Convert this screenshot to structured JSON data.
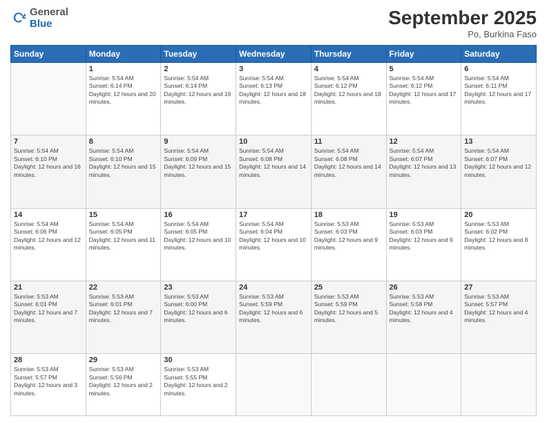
{
  "header": {
    "logo_general": "General",
    "logo_blue": "Blue",
    "month_title": "September 2025",
    "subtitle": "Po, Burkina Faso"
  },
  "weekdays": [
    "Sunday",
    "Monday",
    "Tuesday",
    "Wednesday",
    "Thursday",
    "Friday",
    "Saturday"
  ],
  "weeks": [
    [
      {
        "day": "",
        "sunrise": "",
        "sunset": "",
        "daylight": ""
      },
      {
        "day": "1",
        "sunrise": "Sunrise: 5:54 AM",
        "sunset": "Sunset: 6:14 PM",
        "daylight": "Daylight: 12 hours and 20 minutes."
      },
      {
        "day": "2",
        "sunrise": "Sunrise: 5:54 AM",
        "sunset": "Sunset: 6:14 PM",
        "daylight": "Daylight: 12 hours and 19 minutes."
      },
      {
        "day": "3",
        "sunrise": "Sunrise: 5:54 AM",
        "sunset": "Sunset: 6:13 PM",
        "daylight": "Daylight: 12 hours and 18 minutes."
      },
      {
        "day": "4",
        "sunrise": "Sunrise: 5:54 AM",
        "sunset": "Sunset: 6:12 PM",
        "daylight": "Daylight: 12 hours and 18 minutes."
      },
      {
        "day": "5",
        "sunrise": "Sunrise: 5:54 AM",
        "sunset": "Sunset: 6:12 PM",
        "daylight": "Daylight: 12 hours and 17 minutes."
      },
      {
        "day": "6",
        "sunrise": "Sunrise: 5:54 AM",
        "sunset": "Sunset: 6:11 PM",
        "daylight": "Daylight: 12 hours and 17 minutes."
      }
    ],
    [
      {
        "day": "7",
        "sunrise": "Sunrise: 5:54 AM",
        "sunset": "Sunset: 6:10 PM",
        "daylight": "Daylight: 12 hours and 16 minutes."
      },
      {
        "day": "8",
        "sunrise": "Sunrise: 5:54 AM",
        "sunset": "Sunset: 6:10 PM",
        "daylight": "Daylight: 12 hours and 15 minutes."
      },
      {
        "day": "9",
        "sunrise": "Sunrise: 5:54 AM",
        "sunset": "Sunset: 6:09 PM",
        "daylight": "Daylight: 12 hours and 15 minutes."
      },
      {
        "day": "10",
        "sunrise": "Sunrise: 5:54 AM",
        "sunset": "Sunset: 6:08 PM",
        "daylight": "Daylight: 12 hours and 14 minutes."
      },
      {
        "day": "11",
        "sunrise": "Sunrise: 5:54 AM",
        "sunset": "Sunset: 6:08 PM",
        "daylight": "Daylight: 12 hours and 14 minutes."
      },
      {
        "day": "12",
        "sunrise": "Sunrise: 5:54 AM",
        "sunset": "Sunset: 6:07 PM",
        "daylight": "Daylight: 12 hours and 13 minutes."
      },
      {
        "day": "13",
        "sunrise": "Sunrise: 5:54 AM",
        "sunset": "Sunset: 6:07 PM",
        "daylight": "Daylight: 12 hours and 12 minutes."
      }
    ],
    [
      {
        "day": "14",
        "sunrise": "Sunrise: 5:54 AM",
        "sunset": "Sunset: 6:06 PM",
        "daylight": "Daylight: 12 hours and 12 minutes."
      },
      {
        "day": "15",
        "sunrise": "Sunrise: 5:54 AM",
        "sunset": "Sunset: 6:05 PM",
        "daylight": "Daylight: 12 hours and 11 minutes."
      },
      {
        "day": "16",
        "sunrise": "Sunrise: 5:54 AM",
        "sunset": "Sunset: 6:05 PM",
        "daylight": "Daylight: 12 hours and 10 minutes."
      },
      {
        "day": "17",
        "sunrise": "Sunrise: 5:54 AM",
        "sunset": "Sunset: 6:04 PM",
        "daylight": "Daylight: 12 hours and 10 minutes."
      },
      {
        "day": "18",
        "sunrise": "Sunrise: 5:53 AM",
        "sunset": "Sunset: 6:03 PM",
        "daylight": "Daylight: 12 hours and 9 minutes."
      },
      {
        "day": "19",
        "sunrise": "Sunrise: 5:53 AM",
        "sunset": "Sunset: 6:03 PM",
        "daylight": "Daylight: 12 hours and 9 minutes."
      },
      {
        "day": "20",
        "sunrise": "Sunrise: 5:53 AM",
        "sunset": "Sunset: 6:02 PM",
        "daylight": "Daylight: 12 hours and 8 minutes."
      }
    ],
    [
      {
        "day": "21",
        "sunrise": "Sunrise: 5:53 AM",
        "sunset": "Sunset: 6:01 PM",
        "daylight": "Daylight: 12 hours and 7 minutes."
      },
      {
        "day": "22",
        "sunrise": "Sunrise: 5:53 AM",
        "sunset": "Sunset: 6:01 PM",
        "daylight": "Daylight: 12 hours and 7 minutes."
      },
      {
        "day": "23",
        "sunrise": "Sunrise: 5:53 AM",
        "sunset": "Sunset: 6:00 PM",
        "daylight": "Daylight: 12 hours and 6 minutes."
      },
      {
        "day": "24",
        "sunrise": "Sunrise: 5:53 AM",
        "sunset": "Sunset: 5:59 PM",
        "daylight": "Daylight: 12 hours and 6 minutes."
      },
      {
        "day": "25",
        "sunrise": "Sunrise: 5:53 AM",
        "sunset": "Sunset: 5:59 PM",
        "daylight": "Daylight: 12 hours and 5 minutes."
      },
      {
        "day": "26",
        "sunrise": "Sunrise: 5:53 AM",
        "sunset": "Sunset: 5:58 PM",
        "daylight": "Daylight: 12 hours and 4 minutes."
      },
      {
        "day": "27",
        "sunrise": "Sunrise: 5:53 AM",
        "sunset": "Sunset: 5:57 PM",
        "daylight": "Daylight: 12 hours and 4 minutes."
      }
    ],
    [
      {
        "day": "28",
        "sunrise": "Sunrise: 5:53 AM",
        "sunset": "Sunset: 5:57 PM",
        "daylight": "Daylight: 12 hours and 3 minutes."
      },
      {
        "day": "29",
        "sunrise": "Sunrise: 5:53 AM",
        "sunset": "Sunset: 5:56 PM",
        "daylight": "Daylight: 12 hours and 2 minutes."
      },
      {
        "day": "30",
        "sunrise": "Sunrise: 5:53 AM",
        "sunset": "Sunset: 5:55 PM",
        "daylight": "Daylight: 12 hours and 2 minutes."
      },
      {
        "day": "",
        "sunrise": "",
        "sunset": "",
        "daylight": ""
      },
      {
        "day": "",
        "sunrise": "",
        "sunset": "",
        "daylight": ""
      },
      {
        "day": "",
        "sunrise": "",
        "sunset": "",
        "daylight": ""
      },
      {
        "day": "",
        "sunrise": "",
        "sunset": "",
        "daylight": ""
      }
    ]
  ]
}
